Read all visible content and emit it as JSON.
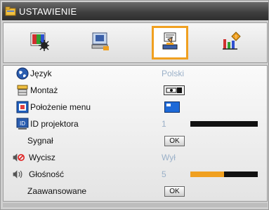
{
  "window": {
    "title": "USTAWIENIE"
  },
  "tabs": [
    {
      "icon": "image-settings-icon",
      "active": false
    },
    {
      "icon": "display-settings-icon",
      "active": false
    },
    {
      "icon": "setup-settings-icon",
      "active": true
    },
    {
      "icon": "options-settings-icon",
      "active": false
    }
  ],
  "menu": {
    "language": {
      "label": "Język",
      "value": "Polski",
      "icon": "globe-icon"
    },
    "mount": {
      "label": "Montaż",
      "icon": "projector-mount-icon"
    },
    "menu_position": {
      "label": "Położenie menu",
      "icon": "menu-position-icon"
    },
    "projector_id": {
      "label": "ID projektora",
      "value": "1",
      "level_fraction": 0.0,
      "icon": "id-icon"
    },
    "signal": {
      "label": "Sygnał",
      "button": "OK"
    },
    "mute": {
      "label": "Wycisz",
      "value": "Wył",
      "icon": "mute-icon"
    },
    "volume": {
      "label": "Głośność",
      "value": "5",
      "level_fraction": 0.5,
      "icon": "speaker-icon"
    },
    "advanced": {
      "label": "Zaawansowane",
      "button": "OK"
    }
  },
  "colors": {
    "accent": "#f0a020",
    "value_text": "#9ab0c8"
  }
}
